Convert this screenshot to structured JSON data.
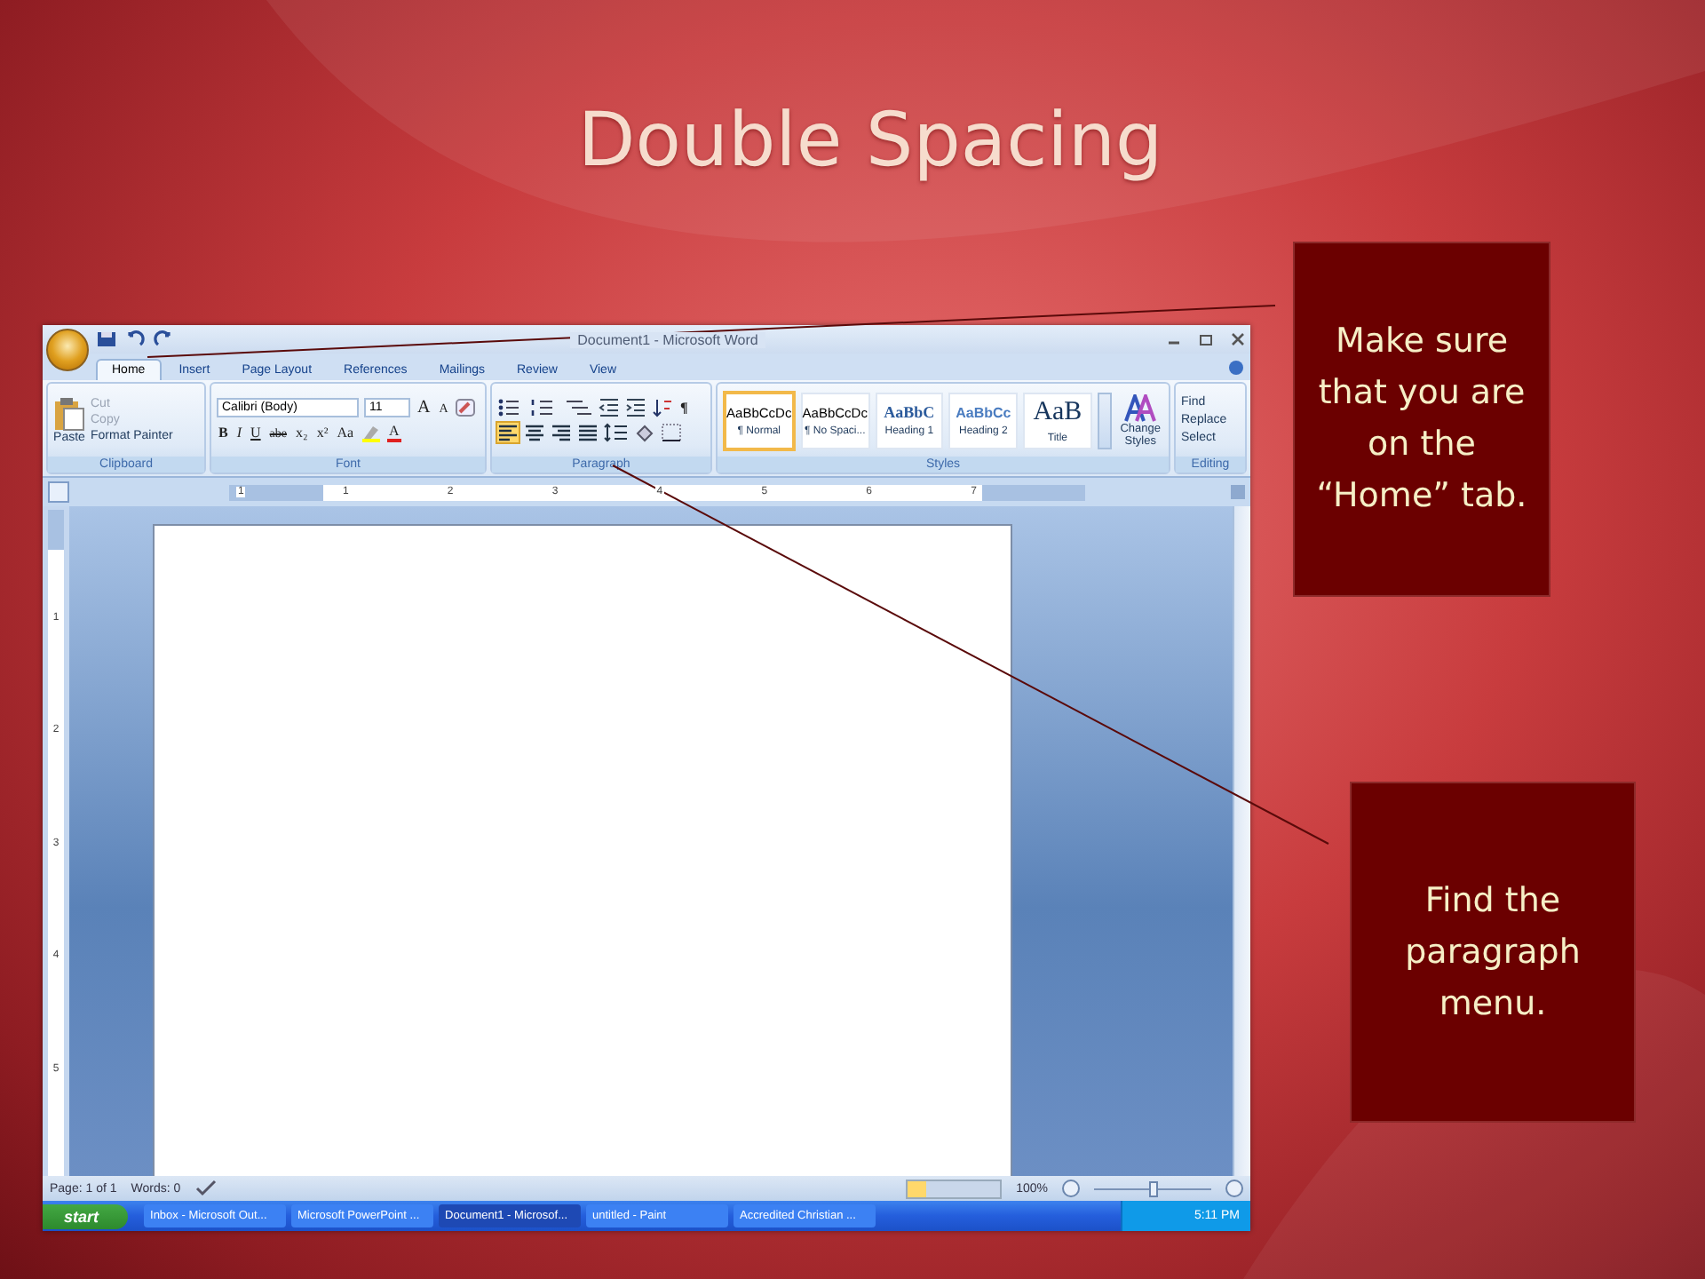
{
  "slide": {
    "title": "Double Spacing"
  },
  "callouts": [
    {
      "text": "Make sure that you are on the “Home” tab."
    },
    {
      "text": "Find the paragraph menu."
    }
  ],
  "word": {
    "title": "Document1 - Microsoft Word",
    "tabs": [
      {
        "label": "Home",
        "selected": true
      },
      {
        "label": "Insert",
        "selected": false
      },
      {
        "label": "Page Layout",
        "selected": false
      },
      {
        "label": "References",
        "selected": false
      },
      {
        "label": "Mailings",
        "selected": false
      },
      {
        "label": "Review",
        "selected": false
      },
      {
        "label": "View",
        "selected": false
      }
    ],
    "clipboard": {
      "paste": "Paste",
      "actions": [
        {
          "label": "Cut",
          "disabled": true
        },
        {
          "label": "Copy",
          "disabled": true
        },
        {
          "label": "Format Painter",
          "disabled": false
        }
      ],
      "label": "Clipboard"
    },
    "font": {
      "family": "Calibri (Body)",
      "size": "11",
      "grow": "A",
      "shrink": "A",
      "buttons": [
        {
          "text": "B",
          "kind": "bold"
        },
        {
          "text": "I",
          "kind": "italic"
        },
        {
          "text": "U",
          "kind": "underline"
        },
        {
          "text": "abe",
          "kind": "strike"
        },
        {
          "text": "x₂",
          "kind": "plain"
        },
        {
          "text": "x²",
          "kind": "plain"
        },
        {
          "text": "Aa",
          "kind": "plain"
        }
      ],
      "color_button": "A",
      "label": "Font"
    },
    "paragraph": {
      "pilcrow": "¶",
      "alignments": [
        {
          "selected": true
        },
        {
          "selected": false
        },
        {
          "selected": false
        },
        {
          "selected": false
        }
      ],
      "label": "Paragraph"
    },
    "styles": {
      "items": [
        {
          "preview": "AaBbCcDc",
          "name": "¶ Normal",
          "kind": "body",
          "selected": true
        },
        {
          "preview": "AaBbCcDc",
          "name": "¶ No Spaci...",
          "kind": "body",
          "selected": false
        },
        {
          "preview": "AaBbC",
          "name": "Heading 1",
          "kind": "heading",
          "selected": false
        },
        {
          "preview": "AaBbCc",
          "name": "Heading 2",
          "kind": "subheading",
          "selected": false
        },
        {
          "preview": "AaB",
          "name": "Title",
          "kind": "title",
          "selected": false
        }
      ],
      "change_styles": "Change Styles",
      "label": "Styles"
    },
    "editing": {
      "items": [
        "Find",
        "Replace",
        "Select"
      ],
      "label": "Editing"
    },
    "ruler": {
      "h_labels": [
        "1",
        "1",
        "2",
        "3",
        "4",
        "5",
        "6",
        "7"
      ],
      "v_labels": [
        "1",
        "2",
        "3",
        "4",
        "5"
      ]
    },
    "status": {
      "page": "Page: 1 of 1",
      "words": "Words: 0",
      "zoom": "100%",
      "zoom_slider": {
        "level": 0.5
      }
    },
    "taskbar": {
      "start": "start",
      "tasks": [
        {
          "label": "Inbox - Microsoft Out...",
          "selected": false
        },
        {
          "label": "Microsoft PowerPoint ...",
          "selected": false
        },
        {
          "label": "Document1 - Microsof...",
          "selected": true
        },
        {
          "label": "untitled - Paint",
          "selected": false
        },
        {
          "label": "Accredited Christian ...",
          "selected": false
        }
      ],
      "clock": "5:11 PM"
    }
  }
}
